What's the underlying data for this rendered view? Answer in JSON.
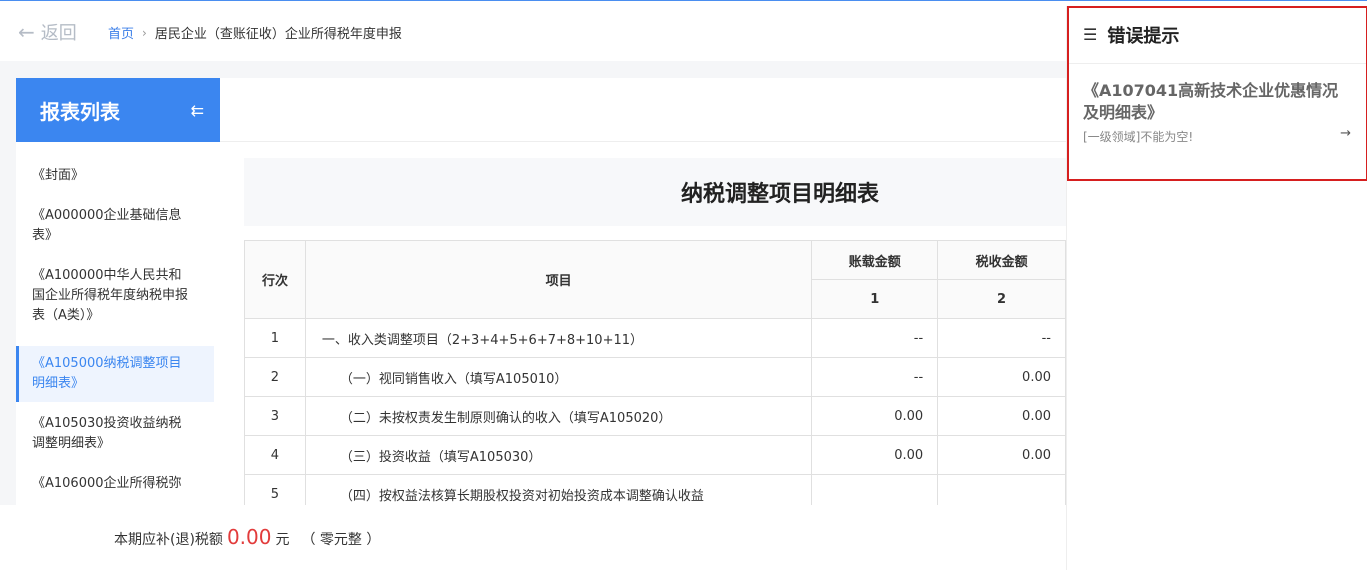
{
  "header": {
    "back_label": "返回",
    "breadcrumb_home": "首页",
    "breadcrumb_sep": "›",
    "breadcrumb_current": "居民企业（查账征收）企业所得税年度申报"
  },
  "sidebar": {
    "title": "报表列表",
    "collapse_glyph": "⇇",
    "items": [
      {
        "label": "《封面》"
      },
      {
        "label": "《A000000企业基础信息表》"
      },
      {
        "label": "《A100000中华人民共和国企业所得税年度纳税申报表（A类）》"
      },
      {
        "label": "《A105000纳税调整项目明细表》"
      },
      {
        "label": "《A105030投资收益纳税调整明细表》"
      },
      {
        "label": "《A106000企业所得税弥"
      }
    ]
  },
  "form": {
    "title": "纳税调整项目明细表",
    "columns": {
      "row_no": "行次",
      "item": "项目",
      "book_amount": "账载金额",
      "tax_amount": "税收金额",
      "book_col_no": "1",
      "tax_col_no": "2"
    },
    "rows": [
      {
        "no": "1",
        "item": "一、收入类调整项目（2+3+4+5+6+7+8+10+11）",
        "book": "--",
        "tax": "--"
      },
      {
        "no": "2",
        "item": "（一）视同销售收入（填写A105010）",
        "book": "--",
        "tax": "0.00"
      },
      {
        "no": "3",
        "item": "（二）未按权责发生制原则确认的收入（填写A105020）",
        "book": "0.00",
        "tax": "0.00"
      },
      {
        "no": "4",
        "item": "（三）投资收益（填写A105030）",
        "book": "0.00",
        "tax": "0.00"
      },
      {
        "no": "5",
        "item": "（四）按权益法核算长期股权投资对初始投资成本调整确认收益",
        "book": "",
        "tax": ""
      }
    ]
  },
  "footer": {
    "label": "本期应补(退)税额",
    "amount": "0.00",
    "unit": "元",
    "amount_cn": "（ 零元整 ）"
  },
  "error_panel": {
    "menu_glyph": "☰",
    "title": "错误提示",
    "errors": [
      {
        "table": "《A107041高新技术企业优惠情况及明细表》",
        "message": "[一级领域]不能为空!",
        "arrow": "→"
      }
    ]
  },
  "colors": {
    "accent": "#3b86f0",
    "error_border": "#d61f1f",
    "amount_red": "#e23b3b"
  }
}
